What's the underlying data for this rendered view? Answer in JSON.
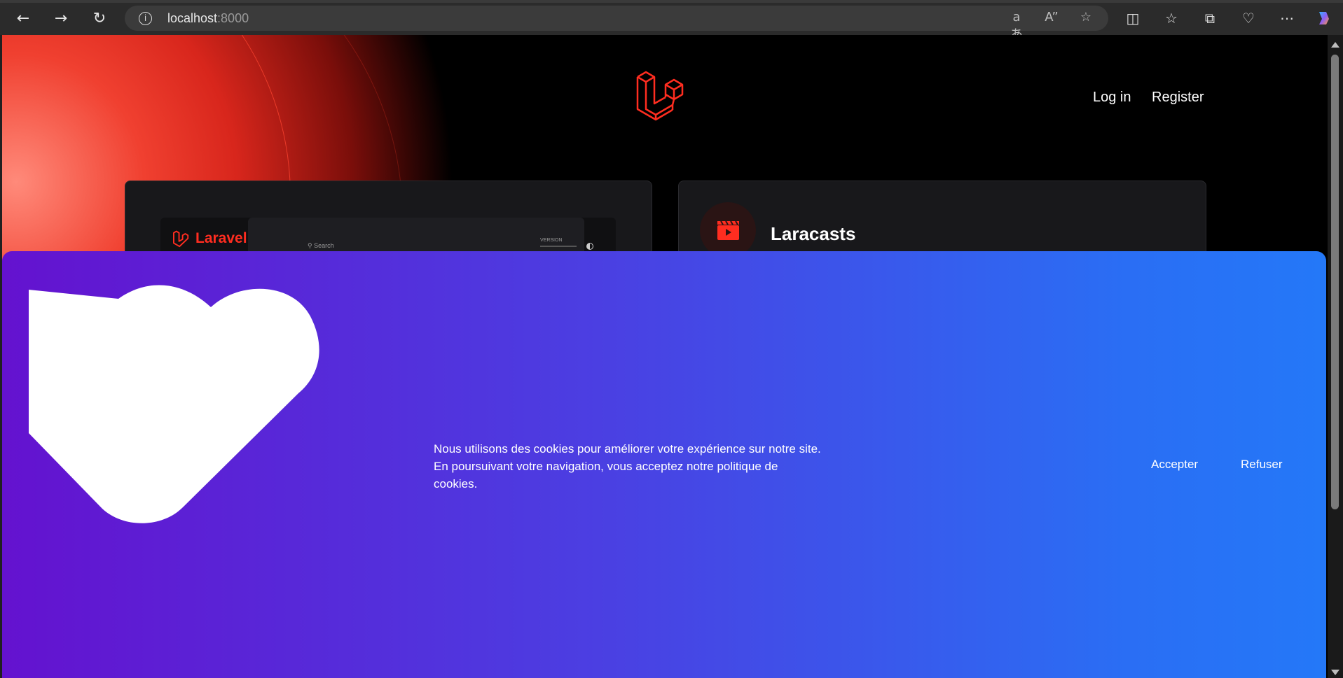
{
  "browser": {
    "url_host": "localhost",
    "url_port": ":8000",
    "icons": {
      "back": "back-arrow-icon",
      "forward": "forward-arrow-icon",
      "refresh": "refresh-icon",
      "info": "info-icon",
      "translate": "translate-icon",
      "read_aloud": "read-aloud-icon",
      "favorite": "star-icon",
      "split": "split-screen-icon",
      "favorites": "favorites-icon",
      "collections": "collections-icon",
      "health": "browser-essentials-icon",
      "more": "more-icon",
      "copilot": "copilot-icon"
    }
  },
  "header": {
    "login_label": "Log in",
    "register_label": "Register"
  },
  "cards": {
    "docs": {
      "mini_logo_text": "Laravel",
      "mini_search": "Search",
      "mini_version": "VERSION"
    },
    "laracasts": {
      "title": "Laracasts"
    }
  },
  "cookie_banner": {
    "line1": "Nous utilisons des cookies pour améliorer votre expérience sur notre site.",
    "line2": "En poursuivant votre navigation, vous acceptez notre politique de",
    "line3": "cookies.",
    "accept_label": "Accepter",
    "refuse_label": "Refuser"
  },
  "colors": {
    "laravel_red": "#ff2d20",
    "gradient_start": "#6412cf",
    "gradient_end": "#2478f8"
  }
}
